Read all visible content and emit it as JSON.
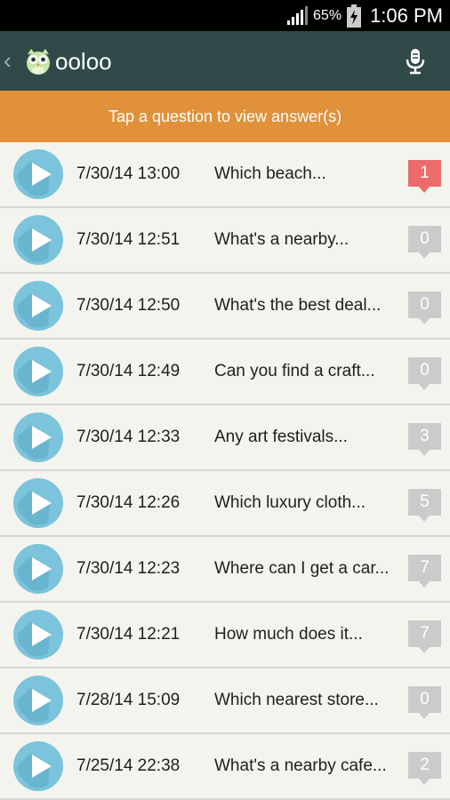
{
  "status_bar": {
    "battery_percent": "65%",
    "time": "1:06 PM",
    "icons": [
      "signal-icon",
      "battery-charging-icon"
    ]
  },
  "app_bar": {
    "back_glyph": "‹",
    "title": "ooloo",
    "icons": [
      "back-chevron-icon",
      "owl-logo-icon",
      "microphone-icon"
    ]
  },
  "hint": "Tap a question to view answer(s)",
  "colors": {
    "app_bar_bg": "#304a4a",
    "banner_bg": "#e0913a",
    "play_circle": "#7cc3dc",
    "badge_zero": "#cbcbcb",
    "badge_new": "#ec6b6b"
  },
  "questions": [
    {
      "timestamp": "7/30/14 13:00",
      "text": "Which beach...",
      "count": "1",
      "highlight": true
    },
    {
      "timestamp": "7/30/14 12:51",
      "text": "What's a nearby...",
      "count": "0",
      "highlight": false
    },
    {
      "timestamp": "7/30/14 12:50",
      "text": "What's the best deal...",
      "count": "0",
      "highlight": false
    },
    {
      "timestamp": "7/30/14 12:49",
      "text": "Can you find a craft...",
      "count": "0",
      "highlight": false
    },
    {
      "timestamp": "7/30/14 12:33",
      "text": "Any art festivals...",
      "count": "3",
      "highlight": false
    },
    {
      "timestamp": "7/30/14 12:26",
      "text": "Which luxury cloth...",
      "count": "5",
      "highlight": false
    },
    {
      "timestamp": "7/30/14 12:23",
      "text": "Where can I get a car...",
      "count": "7",
      "highlight": false
    },
    {
      "timestamp": "7/30/14 12:21",
      "text": "How much does it...",
      "count": "7",
      "highlight": false
    },
    {
      "timestamp": "7/28/14 15:09",
      "text": "Which nearest store...",
      "count": "0",
      "highlight": false
    },
    {
      "timestamp": "7/25/14 22:38",
      "text": "What's a nearby cafe...",
      "count": "2",
      "highlight": false
    }
  ]
}
